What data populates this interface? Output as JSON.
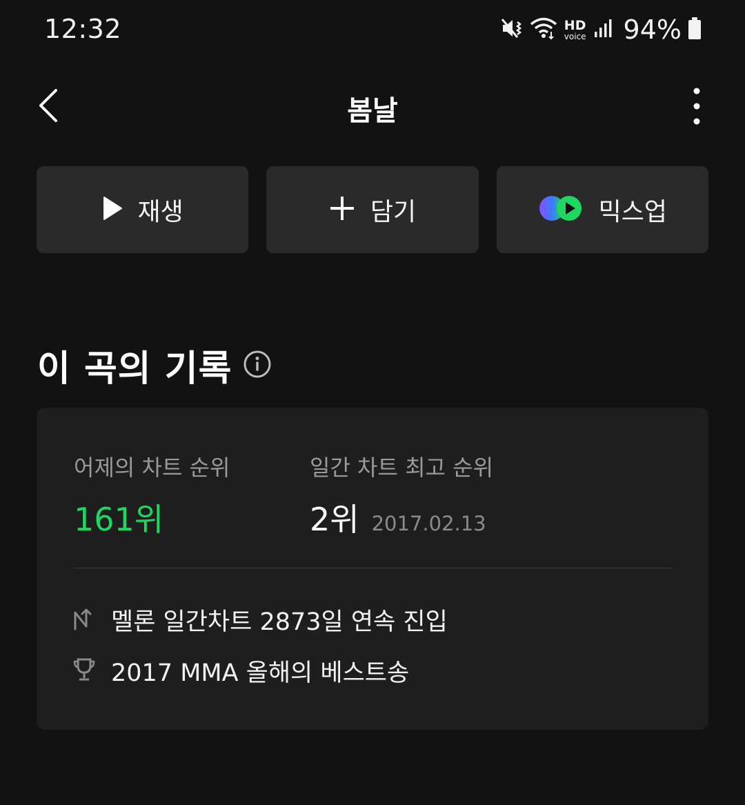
{
  "status_bar": {
    "time": "12:32",
    "hd": "HD",
    "voice": "voice",
    "battery": "94%",
    "icons": [
      "mute-vibrate-icon",
      "wifi-icon",
      "signal-icon",
      "battery-icon"
    ]
  },
  "header": {
    "title": "봄날"
  },
  "actions": {
    "play_label": "재생",
    "add_label": "담기",
    "mixup_label": "믹스업"
  },
  "section": {
    "title": "이 곡의 기록"
  },
  "record": {
    "yesterday_label": "어제의 차트 순위",
    "yesterday_value": "161위",
    "best_label": "일간 차트 최고 순위",
    "best_value": "2위",
    "best_date": "2017.02.13",
    "streak_text": "멜론 일간차트 2873일 연속 진입",
    "award_text": "2017 MMA 올해의 베스트송"
  },
  "colors": {
    "background": "#121212",
    "button_bg": "#2a2a2a",
    "card_bg": "#1e1e1e",
    "accent_green": "#1ed760",
    "mixup_purple": "#7b4dff",
    "mixup_blue": "#3c7bff",
    "mixup_green": "#1ed760"
  }
}
